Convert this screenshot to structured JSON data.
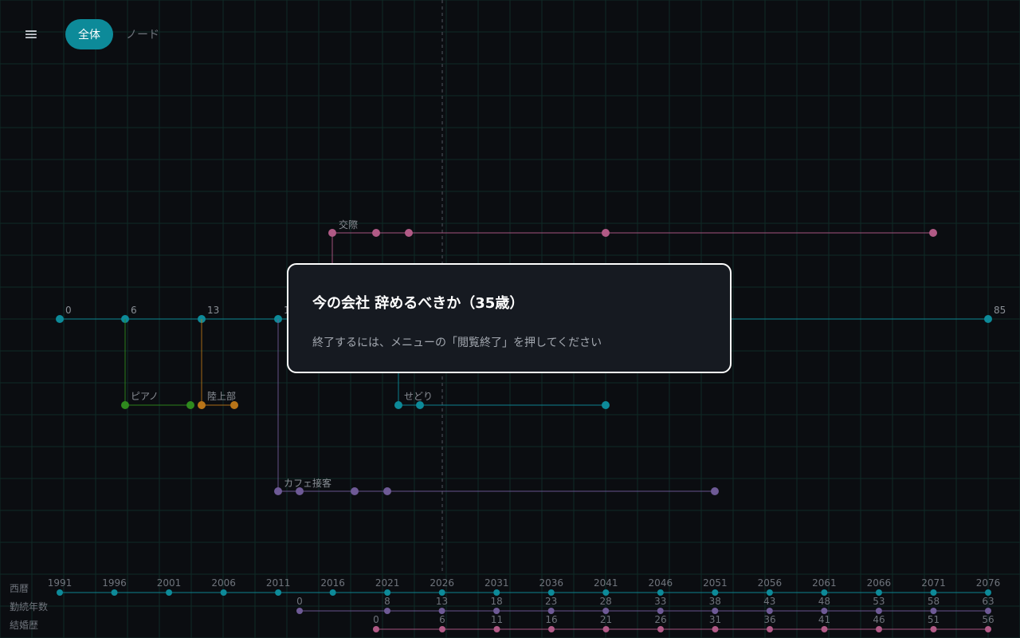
{
  "menu": {
    "icon": "hamburger-menu-icon",
    "glyph": "≡"
  },
  "view_toggle": {
    "options": [
      "全体",
      "ノード"
    ],
    "selected": "全体"
  },
  "colors": {
    "background": "#0b0d11",
    "grid": "#0f2a26",
    "teal": "#0d8a99",
    "pink": "#b15a86",
    "purple": "#6e5a96",
    "green": "#2f8a1e",
    "orange": "#b87418",
    "label": "#8a8f96"
  },
  "timeline": {
    "main_line": {
      "name": "",
      "age_labels": [
        "0",
        "6",
        "13",
        "1",
        "85"
      ]
    },
    "branches": [
      {
        "name": "交際",
        "color": "pink"
      },
      {
        "name": "ピアノ",
        "color": "green"
      },
      {
        "name": "陸上部",
        "color": "orange"
      },
      {
        "name": "せどり",
        "color": "teal"
      },
      {
        "name": "カフェ接客",
        "color": "purple"
      }
    ]
  },
  "axes": {
    "rows": [
      {
        "label": "西暦",
        "color": "teal",
        "ticks": [
          "1991",
          "1996",
          "2001",
          "2006",
          "2011",
          "2016",
          "2021",
          "2026",
          "2031",
          "2036",
          "2041",
          "2046",
          "2051",
          "2056",
          "2061",
          "2066",
          "2071",
          "2076"
        ]
      },
      {
        "label": "勤続年数",
        "color": "purple",
        "ticks": [
          "0",
          "8",
          "13",
          "18",
          "23",
          "28",
          "33",
          "38",
          "43",
          "48",
          "53",
          "58",
          "63"
        ]
      },
      {
        "label": "結婚歴",
        "color": "pink",
        "ticks": [
          "0",
          "6",
          "11",
          "16",
          "21",
          "26",
          "31",
          "36",
          "41",
          "46",
          "51",
          "56"
        ]
      }
    ]
  },
  "modal": {
    "title": "今の会社 辞めるべきか（35歳）",
    "message": "終了するには、メニューの「閲覧終了」を押してください"
  }
}
